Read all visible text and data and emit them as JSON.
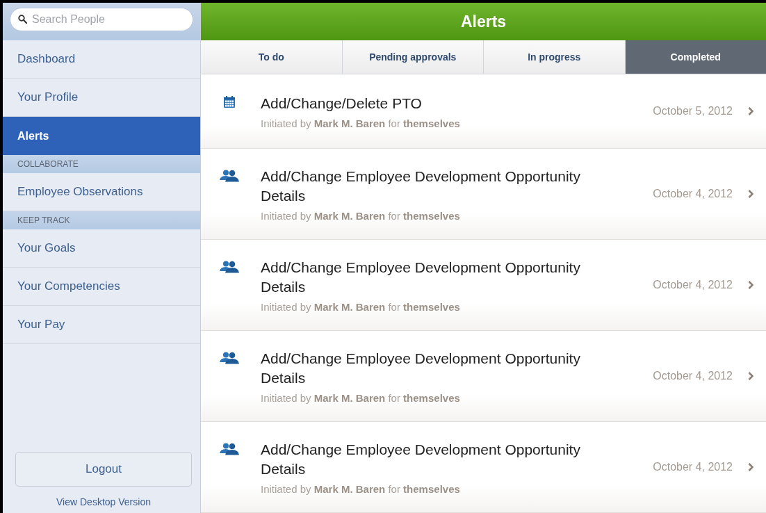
{
  "sidebar": {
    "search": {
      "placeholder": "Search People"
    },
    "items": [
      {
        "kind": "item",
        "label": "Dashboard",
        "selected": false
      },
      {
        "kind": "item",
        "label": "Your Profile",
        "selected": false
      },
      {
        "kind": "item",
        "label": "Alerts",
        "selected": true
      },
      {
        "kind": "section",
        "label": "COLLABORATE"
      },
      {
        "kind": "item",
        "label": "Employee Observations",
        "selected": false
      },
      {
        "kind": "section",
        "label": "KEEP TRACK"
      },
      {
        "kind": "item",
        "label": "Your Goals",
        "selected": false
      },
      {
        "kind": "item",
        "label": "Your Competencies",
        "selected": false
      },
      {
        "kind": "item",
        "label": "Your Pay",
        "selected": false
      }
    ],
    "logout": "Logout",
    "desktop_link": "View Desktop Version"
  },
  "header": {
    "title": "Alerts"
  },
  "tabs": [
    {
      "label": "To do",
      "selected": false
    },
    {
      "label": "Pending approvals",
      "selected": false
    },
    {
      "label": "In progress",
      "selected": false
    },
    {
      "label": "Completed",
      "selected": true
    }
  ],
  "alerts": [
    {
      "kind": "calendar",
      "title": "Add/Change/Delete PTO",
      "subtitle": "Initiated by **Mark M. Baren** for **themselves**",
      "date": "October 5, 2012"
    },
    {
      "kind": "people",
      "title": "Add/Change Employee Development Opportunity Details",
      "subtitle": "Initiated by **Mark M. Baren** for **themselves**",
      "date": "October 4, 2012"
    },
    {
      "kind": "people",
      "title": "Add/Change Employee Development Opportunity Details",
      "subtitle": "Initiated by **Mark M. Baren** for **themselves**",
      "date": "October 4, 2012"
    },
    {
      "kind": "people",
      "title": "Add/Change Employee Development Opportunity Details",
      "subtitle": "Initiated by **Mark M. Baren** for **themselves**",
      "date": "October 4, 2012"
    },
    {
      "kind": "people",
      "title": "Add/Change Employee Development Opportunity Details",
      "subtitle": "Initiated by **Mark M. Baren** for **themselves**",
      "date": "October 4, 2012"
    }
  ]
}
